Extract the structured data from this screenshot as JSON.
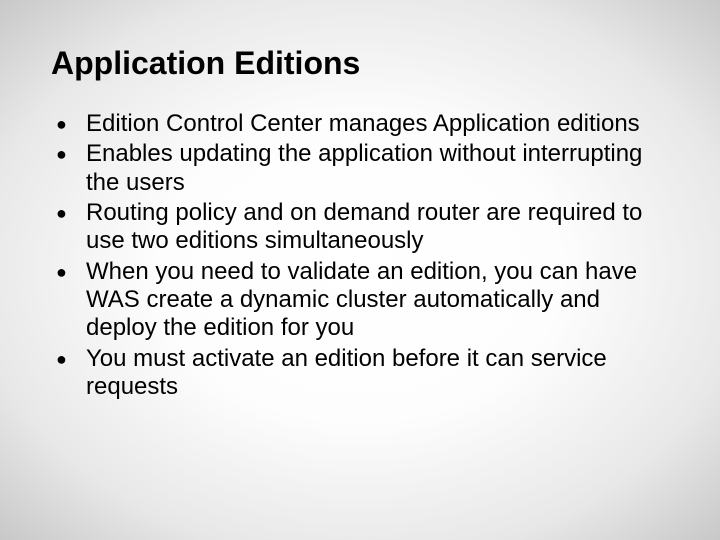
{
  "slide": {
    "title": "Application Editions",
    "bullets": [
      "Edition Control Center manages Application editions",
      "Enables updating the application without interrupting the users",
      "Routing policy and on demand router are required to use two editions simultaneously",
      "When you need to validate an edition, you can have WAS create a dynamic cluster automatically and deploy the edition for you",
      "You must activate an edition before it can service requests"
    ]
  }
}
